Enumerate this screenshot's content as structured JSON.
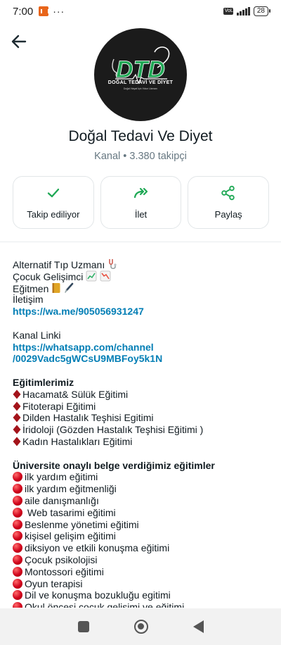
{
  "status_bar": {
    "time": "7:00",
    "dots": "···",
    "network": "VoLTE",
    "battery": "28"
  },
  "channel": {
    "logo_text": "DOĞAL TEDAVİ VE DİYET",
    "logo_subtext": "Doğal Hayat İçin Yolun Uzmanı",
    "name": "Doğal Tedavi Ve Diyet",
    "meta": "Kanal • 3.380 takipçi"
  },
  "actions": [
    {
      "label": "Takip ediliyor",
      "icon": "check-icon"
    },
    {
      "label": "İlet",
      "icon": "forward-icon"
    },
    {
      "label": "Paylaş",
      "icon": "share-icon"
    }
  ],
  "description": {
    "intro": {
      "l1": "Alternatif Tıp Uzmanı",
      "l2": " Çocuk Gelişimci",
      "l3": "Eğitmen",
      "l4": "İletişim",
      "link1": "https://wa.me/905056931247",
      "channel_label": "Kanal Linki",
      "link2a": "https://whatsapp.com/channel",
      "link2b": "/0029Vadc5gWCsU9MBFoy5k1N"
    },
    "trainings_heading": "Eğitimlerimiz",
    "trainings": [
      "Hacamat& Sülük Eğitimi",
      "Fitoterapi Eğitimi",
      "Dilden Hastalık Teşhisi Egitimi",
      "İridoloji (Gözden Hastalık Teşhisi Eğitimi )",
      "Kadın Hastalıkları Eğitimi"
    ],
    "university_heading": "Üniversite onaylı belge verdiğimiz eğitimler",
    "university_courses": [
      "ilk yardım eğitimi",
      "ilk yardım eğitmenliği",
      "aile danışmanlığı",
      " Web tasarimi eğitimi",
      "Beslenme yönetimi eğitimi",
      "kişisel gelişim eğitimi",
      "diksiyon ve etkili konuşma eğitimi",
      "Çocuk psikolojisi",
      "Montossori eğitimi",
      "Oyun terapisi",
      "Dil ve konuşma bozukluğu egitimi",
      "Okul öncesi cocuk gelisimi ve eğitimi"
    ]
  },
  "colors": {
    "accent": "#1fa855",
    "link": "#027eb5",
    "bullet": "#d0021b",
    "diamond": "#a3131a"
  },
  "nav": {
    "icons": [
      "recents-icon",
      "home-icon",
      "back-icon"
    ]
  }
}
